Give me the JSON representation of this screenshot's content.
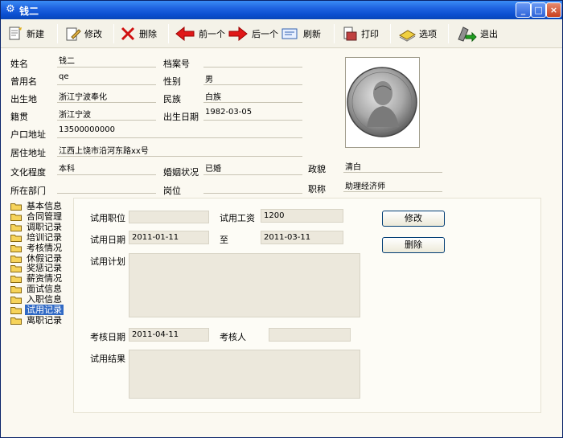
{
  "window": {
    "title": "钱二"
  },
  "toolbar": {
    "new": "新建",
    "edit": "修改",
    "delete": "删除",
    "prev": "前一个",
    "next": "后一个",
    "refresh": "刷新",
    "print": "打印",
    "options": "选项",
    "exit": "退出"
  },
  "profile": {
    "name_label": "姓名",
    "name": "钱二",
    "file_no_label": "档案号",
    "file_no": "",
    "former_name_label": "曾用名",
    "former_name": "qe",
    "gender_label": "性别",
    "gender": "男",
    "birthplace_label": "出生地",
    "birthplace": "浙江宁波奉化",
    "ethnicity_label": "民族",
    "ethnicity": "白族",
    "native_label": "籍贯",
    "native": "浙江宁波",
    "birthdate_label": "出生日期",
    "birthdate": "1982-03-05",
    "household_label": "户口地址",
    "household": "13500000000",
    "residence_label": "居住地址",
    "residence": "江西上饶市沿河东路xx号",
    "education_label": "文化程度",
    "education": "本科",
    "marital_label": "婚姻状况",
    "marital": "已婚",
    "political_label": "政貌",
    "political": "清白",
    "dept_label": "所在部门",
    "dept": "",
    "position_label": "岗位",
    "position": "",
    "title_label": "职称",
    "title": "助理经济师"
  },
  "tree": [
    "基本信息",
    "合同管理",
    "调职记录",
    "培训记录",
    "考核情况",
    "休假记录",
    "奖惩记录",
    "薪资情况",
    "面试信息",
    "入职信息",
    "试用记录",
    "离职记录"
  ],
  "probation": {
    "job_label": "试用职位",
    "job": "",
    "salary_label": "试用工资",
    "salary": "1200",
    "date_label": "试用日期",
    "date_from": "2011-01-11",
    "to_label": "至",
    "date_to": "2011-03-11",
    "plan_label": "试用计划",
    "plan": "",
    "review_date_label": "考核日期",
    "review_date": "2011-04-11",
    "reviewer_label": "考核人",
    "reviewer": "",
    "result_label": "试用结果",
    "result": "",
    "edit_button": "修改",
    "delete_button": "删除"
  },
  "colors": {
    "title_bar": "#0a4fd0",
    "selection": "#316ac5",
    "window_bg": "#fbf9f1"
  }
}
